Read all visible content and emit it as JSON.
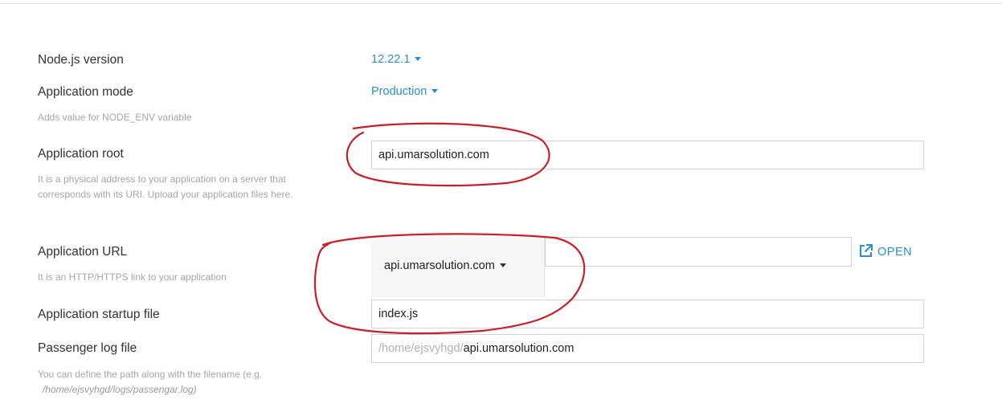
{
  "form": {
    "node_version": {
      "label": "Node.js version",
      "value": "12.22.1"
    },
    "app_mode": {
      "label": "Application mode",
      "value": "Production",
      "help": "Adds value for NODE_ENV variable"
    },
    "app_root": {
      "label": "Application root",
      "help": "It is a physical address to your application on a server that corresponds with its URI. Upload your application files here.",
      "value": "api.umarsolution.com"
    },
    "app_url": {
      "label": "Application URL",
      "help": "It is an HTTP/HTTPS link to your application",
      "domain": "api.umarsolution.com",
      "path_value": "",
      "open_label": "OPEN"
    },
    "startup_file": {
      "label": "Application startup file",
      "value": "index.js"
    },
    "passenger_log": {
      "label": "Passenger log file",
      "prefix": "/home/ejsvyhgd/",
      "value": "api.umarsolution.com",
      "help": "You can define the path along with the filename (e.g.",
      "help_example": "/home/ejsvyhgd/logs/passengar.log)"
    }
  },
  "colors": {
    "accent": "#2a8fcd",
    "annotation": "#c8202a"
  }
}
